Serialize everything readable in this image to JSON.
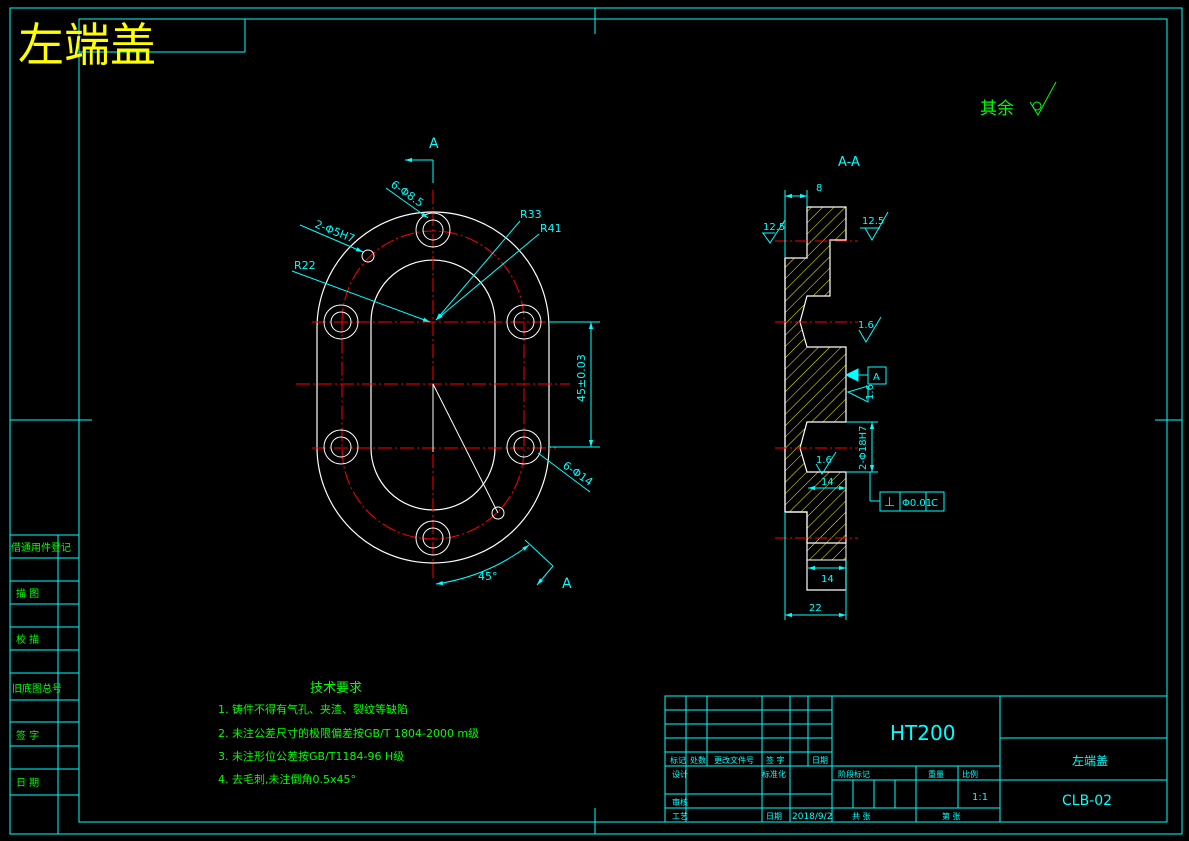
{
  "title": {
    "main": "左端盖"
  },
  "roughness_note": "其余",
  "front_view": {
    "section_mark_top": "A",
    "section_mark_bottom": "A",
    "holes_large": "6-Φ8.5",
    "holes_small": "2-Φ5H7",
    "r_inner": "R22",
    "r_mid": "R33",
    "r_outer": "R41",
    "dim_vertical": "45±0.03",
    "holes_counterbore": "6-Φ14",
    "angle": "45°"
  },
  "section_view": {
    "label": "A-A",
    "dim_top": "8",
    "rough_left": "12.5",
    "rough_right": "12.5",
    "rough_mid": "1.6",
    "datum": "A",
    "rough_face": "1.6",
    "bore": "2-Φ18H7",
    "rough_bore": "1.6",
    "dim_14a": "14",
    "dim_14b": "14",
    "dim_22": "22",
    "tol_symbol": "⊥",
    "tol_value": "Φ0.01",
    "tol_datum": "C"
  },
  "tech_req": {
    "heading": "技术要求",
    "items": [
      "1. 铸件不得有气孔、夹渣、裂纹等缺陷",
      "2. 未注公差尺寸的极限偏差按GB/T 1804-2000 m级",
      "3. 未注形位公差按GB/T1184-96 H级",
      "4. 去毛刺,未注倒角0.5x45°"
    ]
  },
  "left_strip": {
    "items": [
      "借通用件登记",
      "描 图",
      "校 描",
      "旧底图总号",
      "签 字",
      "日 期"
    ]
  },
  "title_block": {
    "material": "HT200",
    "part_name": "左端盖",
    "drawing_no": "CLB-02",
    "scale": "1:1",
    "date": "2018/9/2",
    "headers_row1": [
      "标记",
      "处数",
      "更改文件号",
      "签 字",
      "日期"
    ],
    "designer": "设计",
    "standardize": "标准化",
    "review": "审核",
    "process": "工艺",
    "approve_date": "日期",
    "stage_mark": "阶段标记",
    "weight": "重量",
    "scale_label": "比例",
    "sheets": "共 张",
    "sheet_no": "第 张"
  },
  "colors": {
    "frame": "#00ffff",
    "outline": "#ffffff",
    "center": "#ff0000",
    "dim": "#00ffff",
    "title_yellow": "#ffff00",
    "note_green": "#00ff00"
  }
}
